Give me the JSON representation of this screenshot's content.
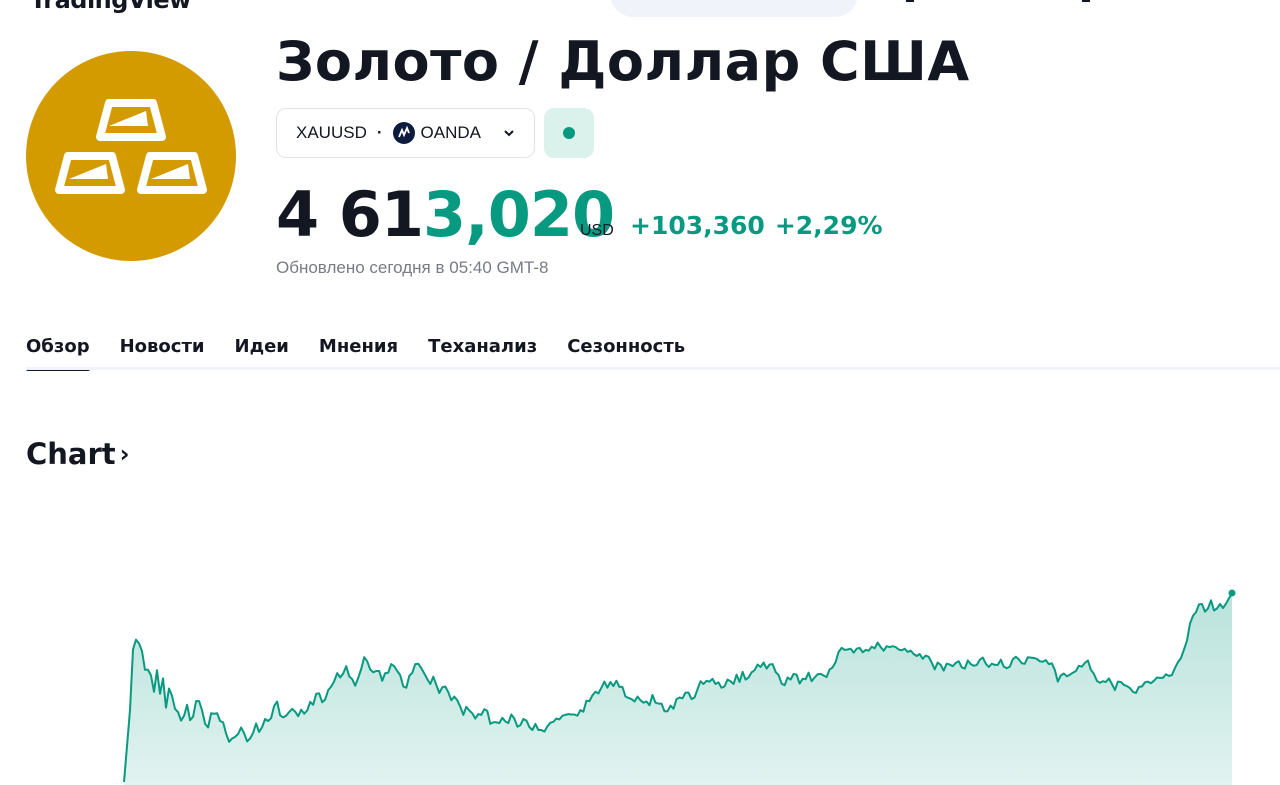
{
  "header": {
    "brand": "TradingView"
  },
  "instrument": {
    "title": "Золото / Доллар США",
    "symbol": "XAUUSD",
    "exchange": "OANDA",
    "logo_icon": "gold-bars-icon",
    "status_color": "#089981"
  },
  "quote": {
    "price_main": "4 61",
    "price_tail": "3,020",
    "currency": "USD",
    "change_abs": "+103,360",
    "change_pct": "+2,29%",
    "updated": "Обновлено сегодня в 05:40 GMT-8"
  },
  "tabs": [
    {
      "label": "Обзор",
      "active": true
    },
    {
      "label": "Новости",
      "active": false
    },
    {
      "label": "Идеи",
      "active": false
    },
    {
      "label": "Мнения",
      "active": false
    },
    {
      "label": "Теханализ",
      "active": false
    },
    {
      "label": "Сезонность",
      "active": false
    }
  ],
  "chart_section": {
    "title": "Chart",
    "arrow": "›"
  },
  "colors": {
    "accent_green": "#089981",
    "gold": "#d49b00",
    "text": "#131722",
    "muted": "#787b86"
  },
  "chart_data": {
    "type": "area",
    "title": "",
    "xlabel": "",
    "ylabel": "",
    "grid": false,
    "legend": "none",
    "series": [
      {
        "values": [
          3300,
          3388,
          3477,
          3626,
          3650,
          3641,
          3622,
          3576,
          3576,
          3562,
          3522,
          3575,
          3517,
          3555,
          3483,
          3530,
          3512,
          3480,
          3472,
          3451,
          3463,
          3490,
          3452,
          3461,
          3499,
          3499,
          3476,
          3443,
          3434,
          3469,
          3468,
          3469,
          3450,
          3447,
          3419,
          3399,
          3407,
          3411,
          3418,
          3434,
          3420,
          3400,
          3407,
          3421,
          3444,
          3423,
          3435,
          3455,
          3450,
          3457,
          3487,
          3498,
          3464,
          3459,
          3463,
          3472,
          3480,
          3473,
          3462,
          3478,
          3468,
          3476,
          3497,
          3490,
          3517,
          3518,
          3496,
          3503,
          3526,
          3535,
          3548,
          3568,
          3557,
          3567,
          3585,
          3560,
          3553,
          3537,
          3556,
          3578,
          3607,
          3597,
          3577,
          3570,
          3573,
          3573,
          3549,
          3568,
          3569,
          3590,
          3585,
          3573,
          3563,
          3535,
          3532,
          3561,
          3569,
          3590,
          3591,
          3580,
          3567,
          3553,
          3541,
          3559,
          3539,
          3519,
          3533,
          3535,
          3521,
          3501,
          3510,
          3501,
          3485,
          3465,
          3485,
          3476,
          3469,
          3456,
          3467,
          3465,
          3479,
          3475,
          3443,
          3447,
          3447,
          3445,
          3458,
          3449,
          3445,
          3466,
          3456,
          3436,
          3440,
          3455,
          3451,
          3435,
          3428,
          3443,
          3428,
          3428,
          3424,
          3437,
          3446,
          3448,
          3456,
          3454,
          3463,
          3465,
          3467,
          3466,
          3466,
          3463,
          3477,
          3473,
          3500,
          3499,
          3513,
          3522,
          3518,
          3532,
          3547,
          3532,
          3546,
          3536,
          3549,
          3534,
          3534,
          3510,
          3507,
          3504,
          3498,
          3510,
          3501,
          3495,
          3498,
          3489,
          3514,
          3495,
          3493,
          3493,
          3474,
          3474,
          3488,
          3480,
          3504,
          3508,
          3506,
          3520,
          3520,
          3504,
          3508,
          3528,
          3548,
          3541,
          3549,
          3547,
          3554,
          3541,
          3545,
          3532,
          3535,
          3552,
          3548,
          3541,
          3564,
          3546,
          3571,
          3552,
          3557,
          3570,
          3575,
          3589,
          3583,
          3594,
          3579,
          3589,
          3590,
          3571,
          3563,
          3542,
          3538,
          3557,
          3552,
          3566,
          3564,
          3542,
          3554,
          3553,
          3569,
          3548,
          3557,
          3565,
          3566,
          3562,
          3558,
          3577,
          3582,
          3595,
          3620,
          3630,
          3625,
          3626,
          3628,
          3618,
          3628,
          3630,
          3619,
          3625,
          3623,
          3633,
          3629,
          3643,
          3632,
          3623,
          3634,
          3632,
          3634,
          3632,
          3626,
          3624,
          3628,
          3620,
          3623,
          3615,
          3610,
          3615,
          3603,
          3611,
          3608,
          3594,
          3577,
          3594,
          3588,
          3574,
          3591,
          3589,
          3585,
          3593,
          3597,
          3582,
          3579,
          3599,
          3590,
          3586,
          3588,
          3601,
          3606,
          3591,
          3583,
          3591,
          3588,
          3588,
          3601,
          3584,
          3580,
          3584,
          3602,
          3608,
          3602,
          3592,
          3591,
          3607,
          3606,
          3605,
          3603,
          3597,
          3596,
          3600,
          3590,
          3592,
          3576,
          3547,
          3562,
          3567,
          3560,
          3564,
          3569,
          3573,
          3586,
          3584,
          3593,
          3599,
          3576,
          3566,
          3549,
          3544,
          3548,
          3546,
          3555,
          3541,
          3526,
          3547,
          3546,
          3539,
          3536,
          3531,
          3522,
          3519,
          3534,
          3535,
          3545,
          3547,
          3543,
          3549,
          3557,
          3556,
          3556,
          3565,
          3561,
          3563,
          3580,
          3595,
          3605,
          3626,
          3648,
          3690,
          3709,
          3718,
          3737,
          3738,
          3719,
          3727,
          3747,
          3722,
          3727,
          3738,
          3728,
          3739,
          3752,
          3765
        ]
      }
    ]
  }
}
